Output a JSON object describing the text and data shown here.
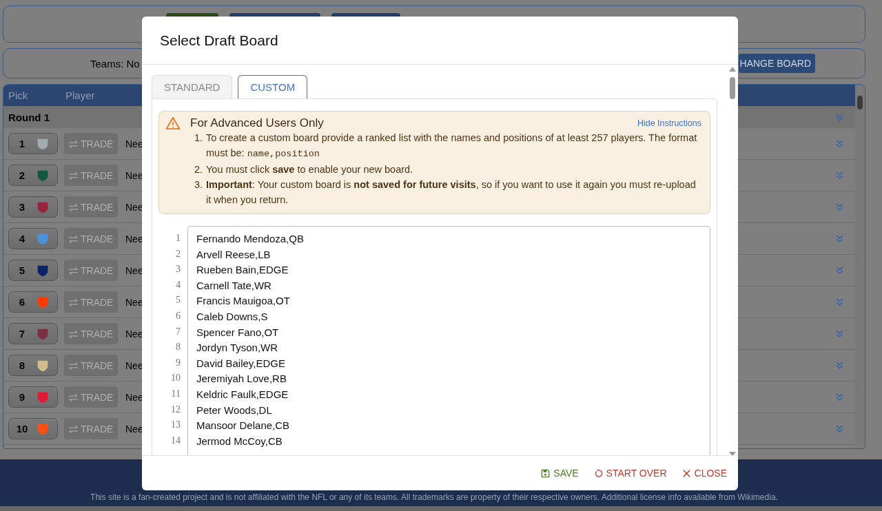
{
  "page": {
    "teams_label": "Teams: No",
    "change_board_button": "HANGE BOARD",
    "table": {
      "columns": [
        "Pick",
        "Player"
      ],
      "round": "Round 1",
      "picks": [
        {
          "number": "1",
          "color": "#a5acaf",
          "trade": "TRADE",
          "need": "Nee"
        },
        {
          "number": "2",
          "color": "#125740",
          "trade": "TRADE",
          "need": "Nee"
        },
        {
          "number": "3",
          "color": "#97233f",
          "trade": "TRADE",
          "need": "Nee"
        },
        {
          "number": "4",
          "color": "#4b92db",
          "trade": "TRADE",
          "need": "Nee"
        },
        {
          "number": "5",
          "color": "#0b2265",
          "trade": "TRADE",
          "need": "Nee"
        },
        {
          "number": "6",
          "color": "#ff3c00",
          "trade": "TRADE",
          "need": "Nee"
        },
        {
          "number": "7",
          "color": "#773141",
          "trade": "TRADE",
          "need": "Nee"
        },
        {
          "number": "8",
          "color": "#d3bc8d",
          "trade": "TRADE",
          "need": "Nee"
        },
        {
          "number": "9",
          "color": "#e31837",
          "trade": "TRADE",
          "need": "Nee"
        },
        {
          "number": "10",
          "color": "#fb4f14",
          "trade": "TRADE",
          "need": "Nee"
        }
      ]
    },
    "footer": "This site is a fan-created project and is not affiliated with the NFL or any of its teams. All trademarks are property of their respective owners. Additional license info available from Wikimedia."
  },
  "dialog": {
    "title": "Select Draft Board",
    "tabs": [
      {
        "label": "STANDARD",
        "selected": false
      },
      {
        "label": "CUSTOM",
        "selected": true
      }
    ],
    "alert": {
      "title": "For Advanced Users Only",
      "link": "Hide Instructions",
      "items": [
        {
          "number": "1.",
          "text": "To create a custom board provide a ranked list with the names and positions of at least 257 players. The format must be: ",
          "code": "name,position"
        },
        {
          "number": "2.",
          "text": "You must click **save** to enable your new board."
        },
        {
          "number": "3.",
          "text": "**Important**: Your custom board is **not saved for future visits**, so if you want to use it again you must re-upload it when you return."
        }
      ]
    },
    "board": {
      "line_numbers": [
        "1",
        "2",
        "3",
        "4",
        "5",
        "6",
        "7",
        "8",
        "9",
        "10",
        "11",
        "12",
        "13",
        "14"
      ],
      "lines": [
        "Fernando Mendoza,QB",
        "Arvell Reese,LB",
        "Rueben Bain,EDGE",
        "Carnell Tate,WR",
        "Francis Mauigoa,OT",
        "Caleb Downs,S",
        "Spencer Fano,OT",
        "Jordyn Tyson,WR",
        "David Bailey,EDGE",
        "Jeremiyah Love,RB",
        "Keldric Faulk,EDGE",
        "Peter Woods,DL",
        "Mansoor Delane,CB",
        "Jermod McCoy,CB"
      ]
    },
    "buttons": [
      {
        "kind": "save",
        "label": "SAVE"
      },
      {
        "kind": "restart",
        "label": "START OVER"
      },
      {
        "kind": "close",
        "label": "CLOSE"
      }
    ]
  }
}
